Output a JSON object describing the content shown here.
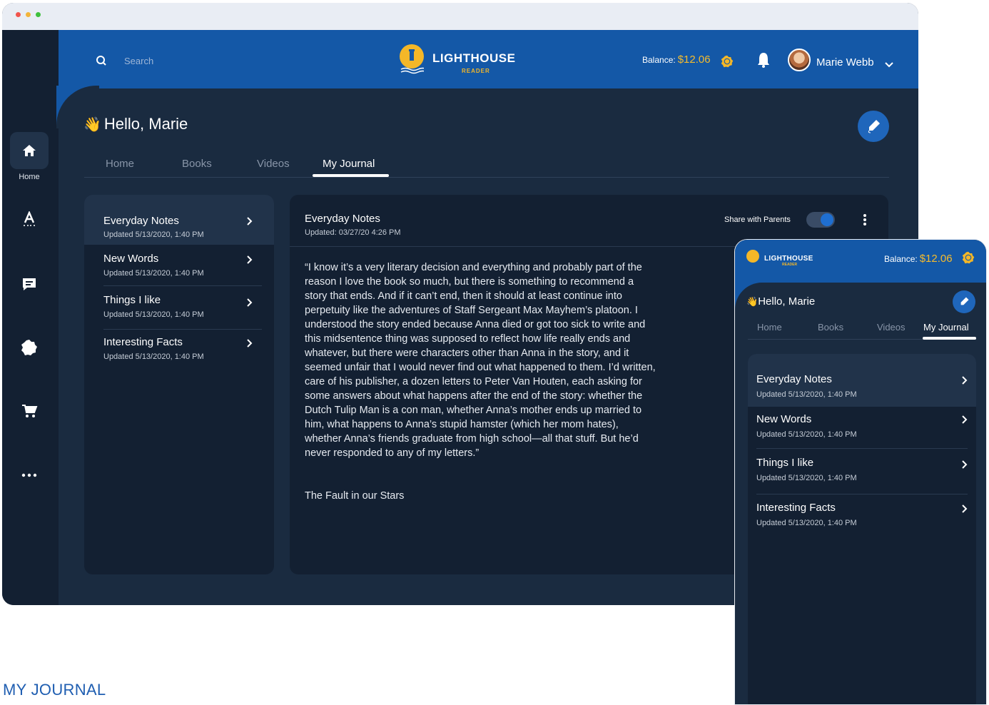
{
  "desktop": {
    "header": {
      "search_placeholder": "Search",
      "logo_title": "LIGHTHOUSE",
      "logo_subtitle": "READER",
      "balance_label": "Balance:",
      "balance_amount": "$12.06",
      "user_name": "Marie Webb"
    },
    "sidebar": {
      "items": [
        {
          "label": "Home",
          "icon": "home-icon",
          "active": true
        },
        {
          "label": "",
          "icon": "vocabulary-icon"
        },
        {
          "label": "",
          "icon": "message-icon"
        },
        {
          "label": "",
          "icon": "badge-icon"
        },
        {
          "label": "",
          "icon": "cart-icon"
        },
        {
          "label": "",
          "icon": "more-icon"
        }
      ]
    },
    "greeting": "Hello, Marie",
    "tabs": [
      "Home",
      "Books",
      "Videos",
      "My Journal"
    ],
    "active_tab": "My Journal",
    "journal_list": [
      {
        "title": "Everyday Notes",
        "updated": "Updated 5/13/2020, 1:40 PM"
      },
      {
        "title": "New Words",
        "updated": "Updated 5/13/2020, 1:40 PM"
      },
      {
        "title": "Things I like",
        "updated": "Updated 5/13/2020, 1:40 PM"
      },
      {
        "title": "Interesting Facts",
        "updated": "Updated 5/13/2020, 1:40 PM"
      }
    ],
    "entry": {
      "title": "Everyday Notes",
      "updated": "Updated: 03/27/20 4:26 PM",
      "share_label": "Share with Parents",
      "share_enabled": true,
      "body": "“I know it’s a very literary decision and everything and probably part of the reason I love the book so much, but there is something to recommend a story that ends. And if it can’t end, then it should at least continue into perpetuity like the adventures of Staff Sergeant Max Mayhem’s platoon. I understood the story ended because Anna died or got too sick to write and this midsentence thing was supposed to reflect how life really ends and whatever, but there were characters other than Anna in the story, and it seemed unfair that I would never find out what happened to them. I’d written, care of his publisher, a dozen letters to Peter Van Houten, each asking for some answers about what happens after the end of the story: whether the Dutch Tulip Man is a con man, whether Anna’s mother ends up married to him, what happens to Anna’s stupid hamster (which her mom hates), whether Anna’s friends graduate from high school—all that stuff. But he’d never responded to any of my letters.”",
      "source": "The Fault in our Stars"
    }
  },
  "mobile": {
    "logo_title": "LIGHTHOUSE",
    "logo_subtitle": "READER",
    "balance_label": "Balance:",
    "balance_amount": "$12.06",
    "greeting": "Hello, Marie",
    "tabs": [
      "Home",
      "Books",
      "Videos",
      "My Journal"
    ],
    "journal_list": [
      {
        "title": "Everyday Notes",
        "updated": "Updated 5/13/2020, 1:40 PM"
      },
      {
        "title": "New Words",
        "updated": "Updated 5/13/2020, 1:40 PM"
      },
      {
        "title": "Things I like",
        "updated": "Updated 5/13/2020, 1:40 PM"
      },
      {
        "title": "Interesting Facts",
        "updated": "Updated 5/13/2020, 1:40 PM"
      }
    ]
  },
  "caption": "MY JOURNAL",
  "colors": {
    "brand_blue": "#1458a7",
    "panel_dark": "#132032",
    "background_dark": "#1a2b40",
    "accent_gold": "#f4b728"
  }
}
